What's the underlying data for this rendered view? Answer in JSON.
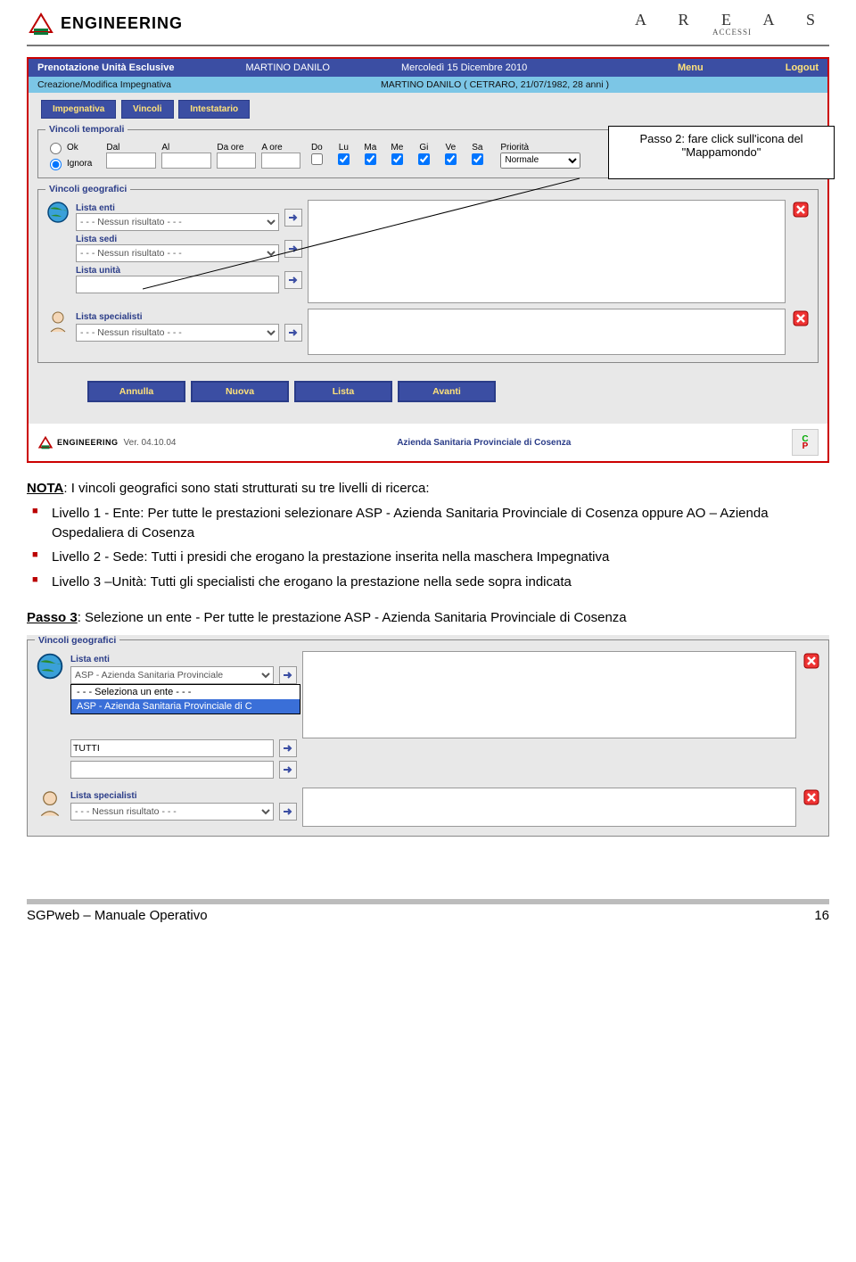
{
  "header": {
    "engineering": "ENGINEERING",
    "areas_main": "A R E A S",
    "areas_sub": "ACCESSI"
  },
  "callout": {
    "line1": "Passo 2: fare click sull'icona del",
    "line2": "\"Mappamondo\""
  },
  "app": {
    "titlebar": {
      "title": "Prenotazione Unità Esclusive",
      "user": "MARTINO DANILO",
      "date": "Mercoledì 15 Dicembre 2010",
      "menu": "Menu",
      "logout": "Logout"
    },
    "subbar": {
      "left": "Creazione/Modifica Impegnativa",
      "right": "MARTINO DANILO ( CETRARO, 21/07/1982, 28 anni )"
    },
    "tabs": {
      "t1": "Impegnativa",
      "t2": "Vincoli",
      "t3": "Intestatario"
    },
    "vt_legend": "Vincoli temporali",
    "vt": {
      "ok": "Ok",
      "ignora": "Ignora",
      "dal": "Dal",
      "al": "Al",
      "daore": "Da ore",
      "aore": "A ore",
      "do": "Do",
      "lu": "Lu",
      "ma": "Ma",
      "me": "Me",
      "gi": "Gi",
      "ve": "Ve",
      "sa": "Sa",
      "priorita": "Priorità",
      "normale": "Normale"
    },
    "vg_legend": "Vincoli geografici",
    "vg": {
      "lista_enti": "Lista enti",
      "lista_sedi": "Lista sedi",
      "lista_unita": "Lista unità",
      "nessuno": "- - - Nessun risultato - - -",
      "empty": ""
    },
    "spec": {
      "label": "Lista specialisti",
      "nessuno": "- - - Nessun risultato - - -"
    },
    "buttons": {
      "annulla": "Annulla",
      "nuova": "Nuova",
      "lista": "Lista",
      "avanti": "Avanti"
    },
    "footer": {
      "eng": "ENGINEERING",
      "ver": "Ver. 04.10.04",
      "client": "Azienda Sanitaria Provinciale di Cosenza"
    }
  },
  "body": {
    "nota_label": "NOTA",
    "nota_text": ": I vincoli geografici sono stati strutturati su tre livelli di ricerca:",
    "b1": "Livello 1 - Ente: Per tutte le prestazioni selezionare ASP -  Azienda Sanitaria Provinciale di Cosenza oppure AO – Azienda Ospedaliera di Cosenza",
    "b2": "Livello 2 - Sede: Tutti i presidi che erogano la prestazione inserita nella maschera Impegnativa",
    "b3": "Livello 3 –Unità: Tutti gli specialisti che erogano la prestazione nella sede sopra indicata",
    "passo3_label": "Passo 3",
    "passo3_text": ": Selezione un ente - Per tutte le prestazione ASP -  Azienda Sanitaria Provinciale di Cosenza"
  },
  "step3": {
    "vg_legend": "Vincoli geografici",
    "lista_enti": "Lista enti",
    "selected": "ASP - Azienda Sanitaria Provinciale",
    "opt1": "- - - Seleziona un ente - - -",
    "opt2": "ASP - Azienda Sanitaria Provinciale di C",
    "tutti": "TUTTI",
    "empty": "",
    "spec_label": "Lista specialisti",
    "spec_val": "- - - Nessun risultato - - -"
  },
  "footer": {
    "left": "SGPweb – Manuale Operativo",
    "right": "16"
  }
}
